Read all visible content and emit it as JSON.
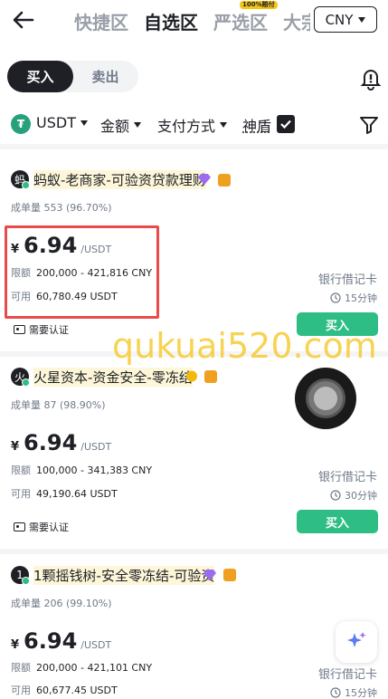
{
  "nav": {
    "tabs": [
      "快捷区",
      "自选区",
      "严选区",
      "大宗"
    ],
    "badge": "100%赔付",
    "currency": "CNY"
  },
  "trade": {
    "buy": "买入",
    "sell": "卖出"
  },
  "filters": {
    "coin": "USDT",
    "amount": "金额",
    "payment": "支付方式",
    "shield": "神盾"
  },
  "offers": [
    {
      "avatar": "蚂",
      "name": "蚂蚁-老商家-可验资贷款理财",
      "stats_label": "成单量",
      "stats": "553 (96.70%)",
      "currency_symbol": "¥",
      "price": "6.94",
      "unit": "/USDT",
      "limit_label": "限额",
      "limit": "200,000 - 421,816 CNY",
      "available_label": "可用",
      "available": "60,780.49 USDT",
      "payment": "银行借记卡",
      "time": "15分钟",
      "buy": "买入",
      "verify": "需要认证"
    },
    {
      "avatar": "火",
      "name": "火星资本-资金安全-零冻结",
      "stats_label": "成单量",
      "stats": "87 (98.90%)",
      "currency_symbol": "¥",
      "price": "6.94",
      "unit": "/USDT",
      "limit_label": "限额",
      "limit": "100,000 - 341,383 CNY",
      "available_label": "可用",
      "available": "49,190.64 USDT",
      "payment": "银行借记卡",
      "time": "30分钟",
      "buy": "买入",
      "verify": "需要认证"
    },
    {
      "avatar": "1",
      "name": "1颗摇钱树-安全零冻结-可验资",
      "stats_label": "成单量",
      "stats": "206 (99.10%)",
      "currency_symbol": "¥",
      "price": "6.94",
      "unit": "/USDT",
      "limit_label": "限额",
      "limit": "200,000 - 421,101 CNY",
      "available_label": "可用",
      "available": "60,677.45 USDT",
      "payment": "银行借记卡",
      "time": "15分钟"
    }
  ],
  "watermark": "qukuai520.com",
  "colors": {
    "buy_green": "#2ebd85",
    "highlight_red": "#e94b4b",
    "watermark_yellow": "#f5c518"
  }
}
